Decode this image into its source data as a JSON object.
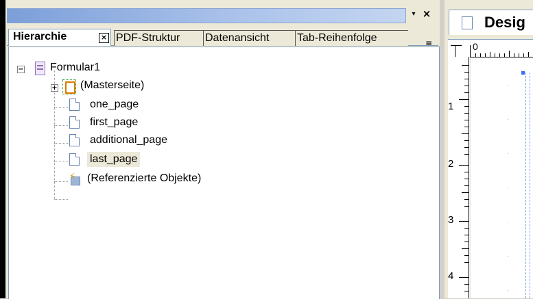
{
  "panel": {
    "pin_glyph": "▾",
    "close_glyph": "×",
    "tabs": [
      {
        "label": "Hierarchie"
      },
      {
        "label": "PDF-Struktur"
      },
      {
        "label": "Datenansicht"
      },
      {
        "label": "Tab-Reihenfolge"
      }
    ],
    "active_tab_close": "×"
  },
  "tree": {
    "root": {
      "label": "Formular1",
      "expander": "−"
    },
    "items": [
      {
        "label": "(Masterseite)",
        "expander": "+"
      },
      {
        "label": "one_page"
      },
      {
        "label": "first_page"
      },
      {
        "label": "additional_page"
      },
      {
        "label": "last_page",
        "selected": true
      },
      {
        "label": "(Referenzierte Objekte)"
      }
    ]
  },
  "design_view": {
    "tab_label": "Desig",
    "ruler_top_zero": "0",
    "ruler_left_numbers": [
      "1",
      "2",
      "3",
      "4"
    ]
  },
  "colors": {
    "titlebar_start": "#7c9fd9",
    "selection": "#ece9d8",
    "panel_bg": "#ece9d8"
  }
}
